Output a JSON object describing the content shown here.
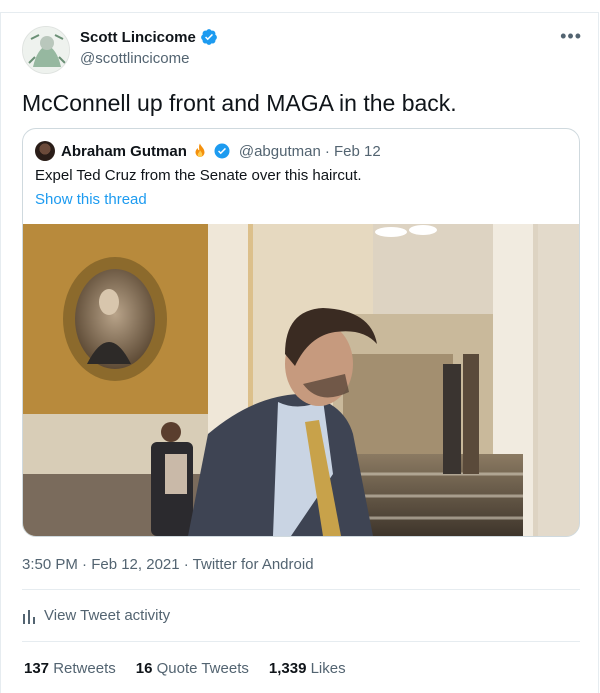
{
  "author": {
    "name": "Scott Lincicome",
    "handle": "@scottlincicome"
  },
  "tweet": {
    "text": "McConnell up front and MAGA in the back."
  },
  "quoted": {
    "name": "Abraham Gutman",
    "handle": "@abgutman",
    "date": "· Feb 12",
    "text": "Expel Ted Cruz from the Senate over this haircut.",
    "show_thread": "Show this thread"
  },
  "meta": {
    "timestamp": "3:50 PM · Feb 12, 2021 · Twitter for Android"
  },
  "activity": {
    "label": "View Tweet activity"
  },
  "stats": {
    "retweets_count": "137",
    "retweets_label": "Retweets",
    "quotes_count": "16",
    "quotes_label": "Quote Tweets",
    "likes_count": "1,339",
    "likes_label": "Likes"
  },
  "colors": {
    "accent": "#1d9bf0",
    "secondary_text": "#536471"
  },
  "icons": [
    "verified-badge-icon",
    "more-options-icon",
    "fire-emoji-icon",
    "analytics-bars-icon"
  ]
}
